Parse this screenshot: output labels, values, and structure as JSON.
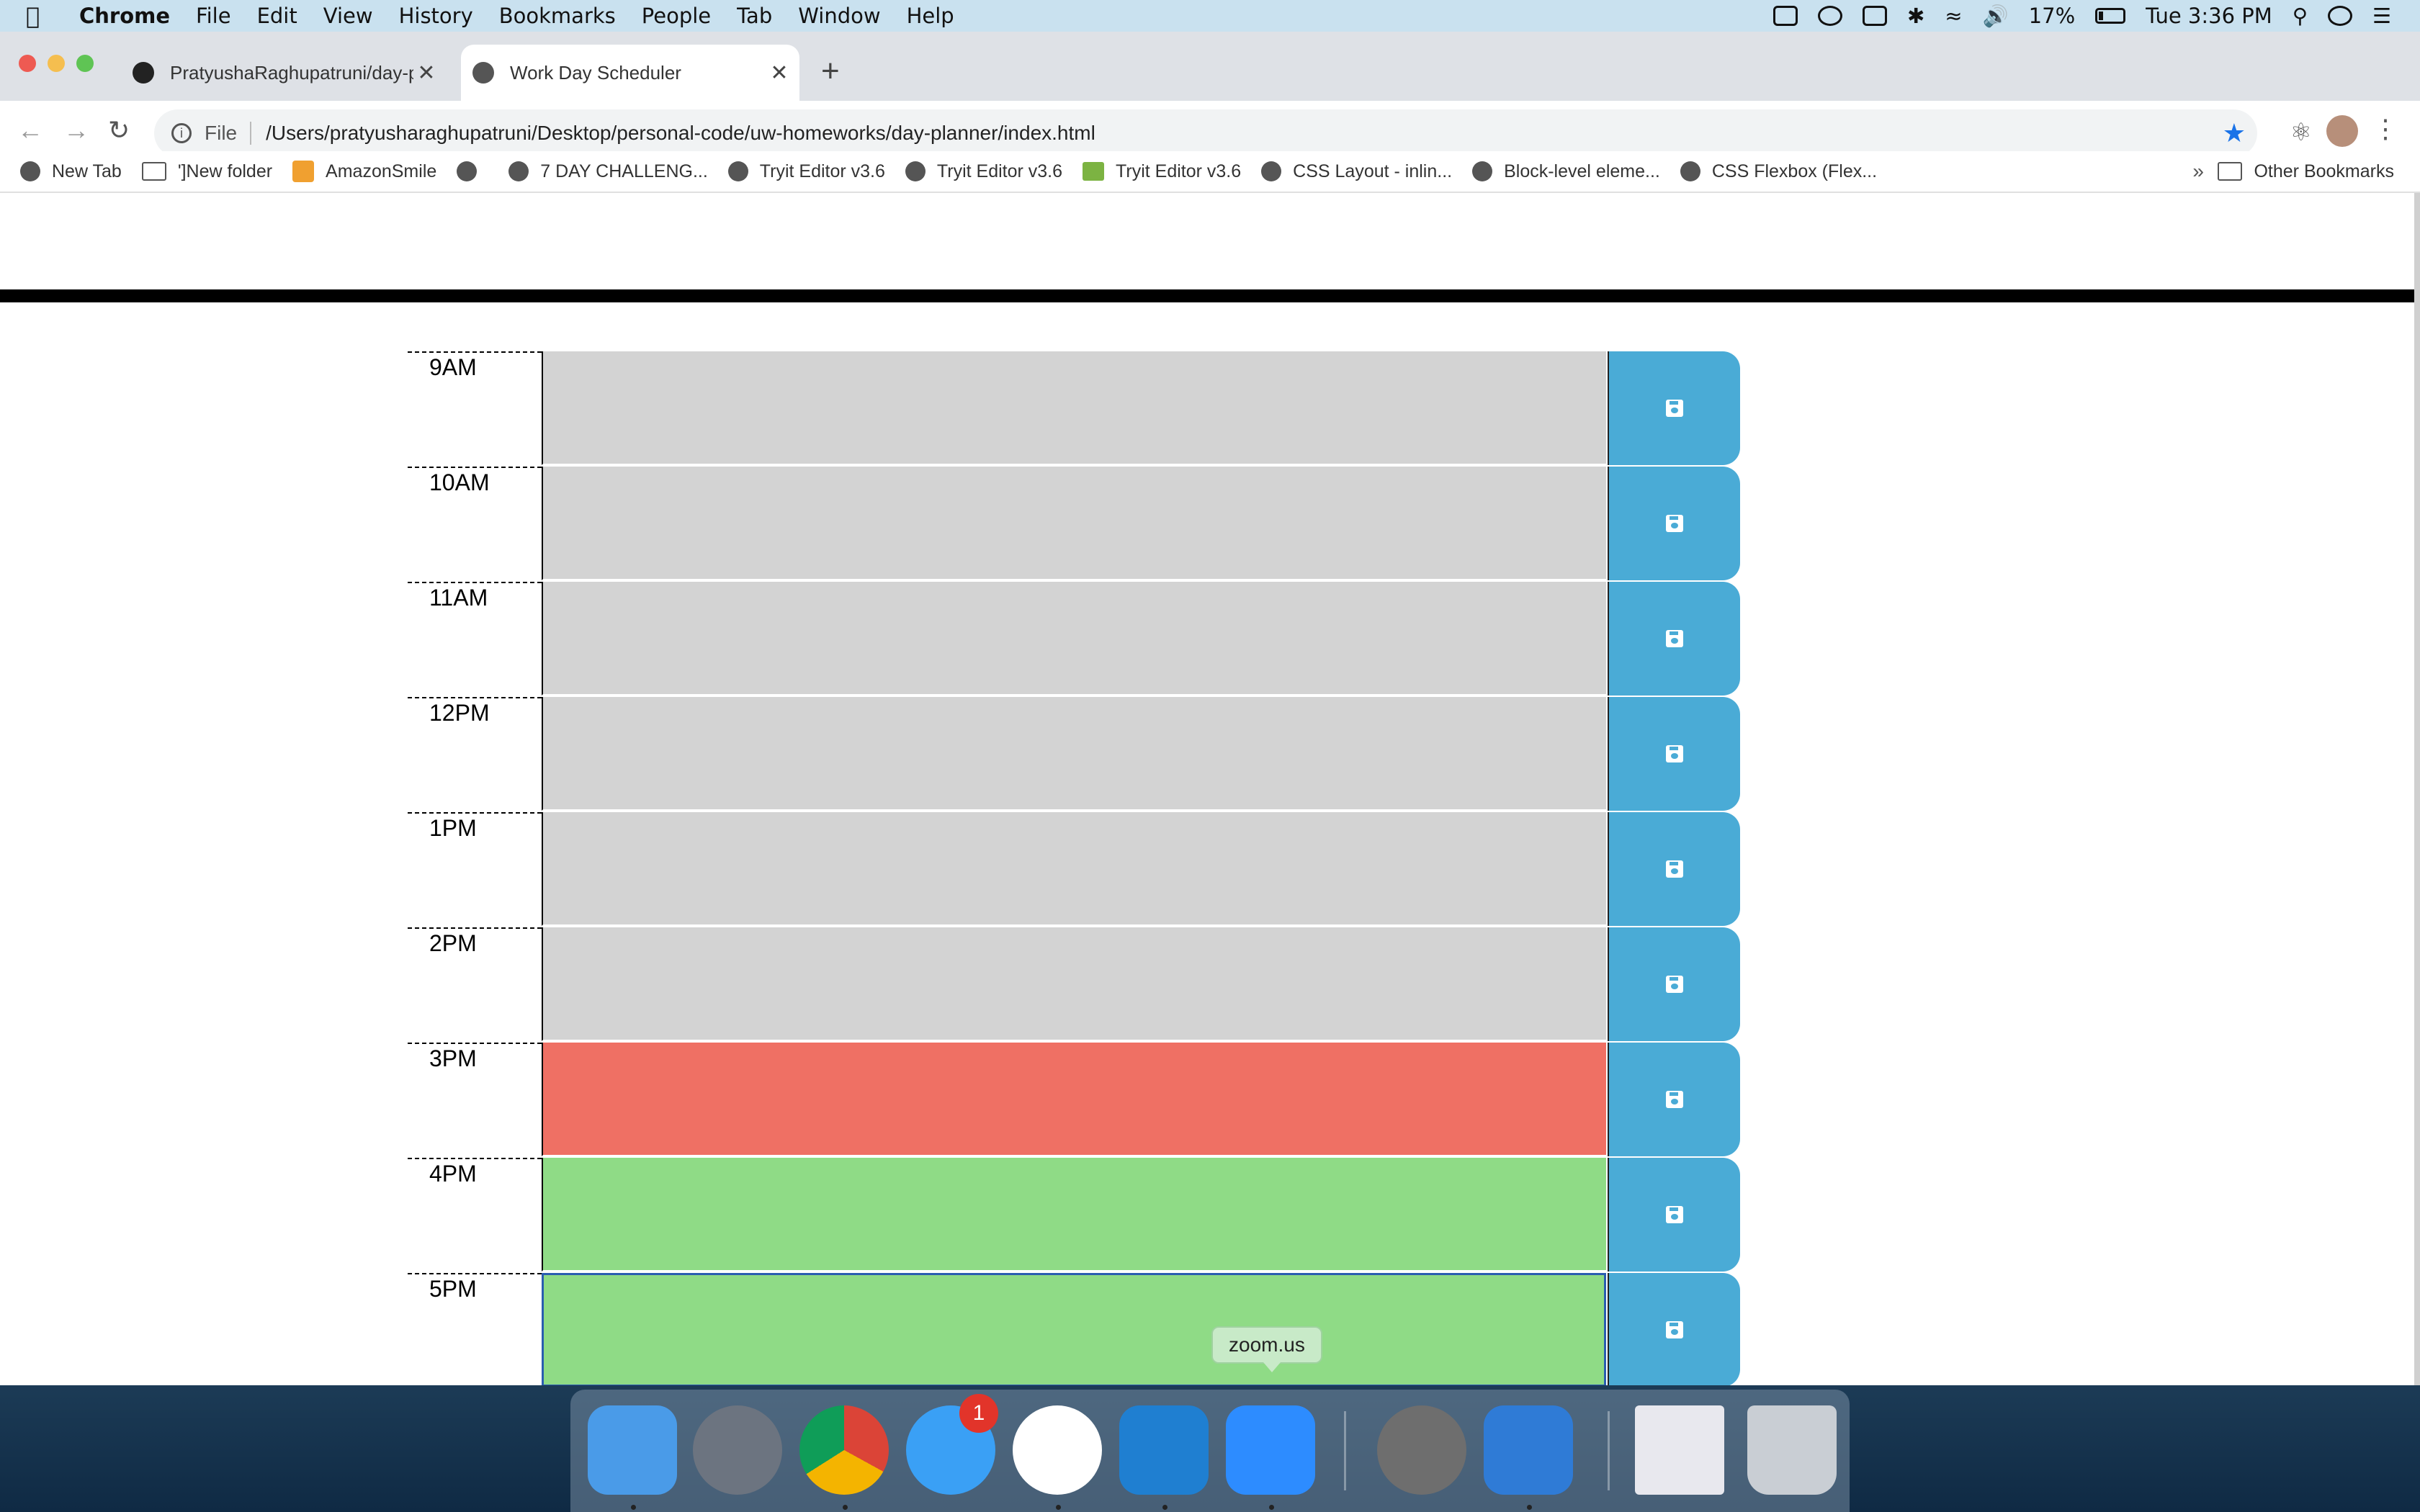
{
  "menubar": {
    "app_name": "Chrome",
    "items": [
      "File",
      "Edit",
      "View",
      "History",
      "Bookmarks",
      "People",
      "Tab",
      "Window",
      "Help"
    ],
    "battery": "17%",
    "clock": "Tue 3:36 PM"
  },
  "tabs": [
    {
      "label": "PratyushaRaghupatruni/day-pl",
      "icon": "github-icon",
      "active": false
    },
    {
      "label": "Work Day Scheduler",
      "icon": "globe-icon",
      "active": true
    }
  ],
  "omnibox": {
    "scheme": "File",
    "url": "/Users/pratyusharaghupatruni/Desktop/personal-code/uw-homeworks/day-planner/index.html"
  },
  "bookmarks": {
    "items": [
      {
        "label": "New Tab",
        "icon": "globe-icon"
      },
      {
        "label": "']New folder",
        "icon": "folder-icon"
      },
      {
        "label": "AmazonSmile",
        "icon": "amazon-icon"
      },
      {
        "label": "",
        "icon": "globe-icon"
      },
      {
        "label": "7 DAY CHALLENG...",
        "icon": "globe-icon"
      },
      {
        "label": "Tryit Editor v3.6",
        "icon": "globe-icon"
      },
      {
        "label": "Tryit Editor v3.6",
        "icon": "globe-icon"
      },
      {
        "label": "Tryit Editor v3.6",
        "icon": "w3schools-icon"
      },
      {
        "label": "CSS Layout - inlin...",
        "icon": "globe-icon"
      },
      {
        "label": "Block-level eleme...",
        "icon": "globe-icon"
      },
      {
        "label": "CSS Flexbox (Flex...",
        "icon": "globe-icon"
      }
    ],
    "more": "»",
    "other": "Other Bookmarks"
  },
  "scheduler": {
    "rows": [
      {
        "hour": "9AM",
        "state": "past",
        "text": ""
      },
      {
        "hour": "10AM",
        "state": "past",
        "text": ""
      },
      {
        "hour": "11AM",
        "state": "past",
        "text": ""
      },
      {
        "hour": "12PM",
        "state": "past",
        "text": ""
      },
      {
        "hour": "1PM",
        "state": "past",
        "text": ""
      },
      {
        "hour": "2PM",
        "state": "past",
        "text": ""
      },
      {
        "hour": "3PM",
        "state": "present",
        "text": ""
      },
      {
        "hour": "4PM",
        "state": "future",
        "text": ""
      },
      {
        "hour": "5PM",
        "state": "future",
        "text": ""
      }
    ],
    "colors": {
      "past": "#d3d3d3",
      "present": "#ef7064",
      "future": "#8fdb86",
      "save": "#4aabd6"
    }
  },
  "dock": {
    "tooltip": "zoom.us",
    "messages_badge": "1",
    "apps": [
      "finder",
      "launchpad",
      "chrome",
      "messages",
      "slack",
      "vscode",
      "zoom",
      "system-preferences",
      "xcode",
      "preview-window",
      "trash"
    ]
  }
}
